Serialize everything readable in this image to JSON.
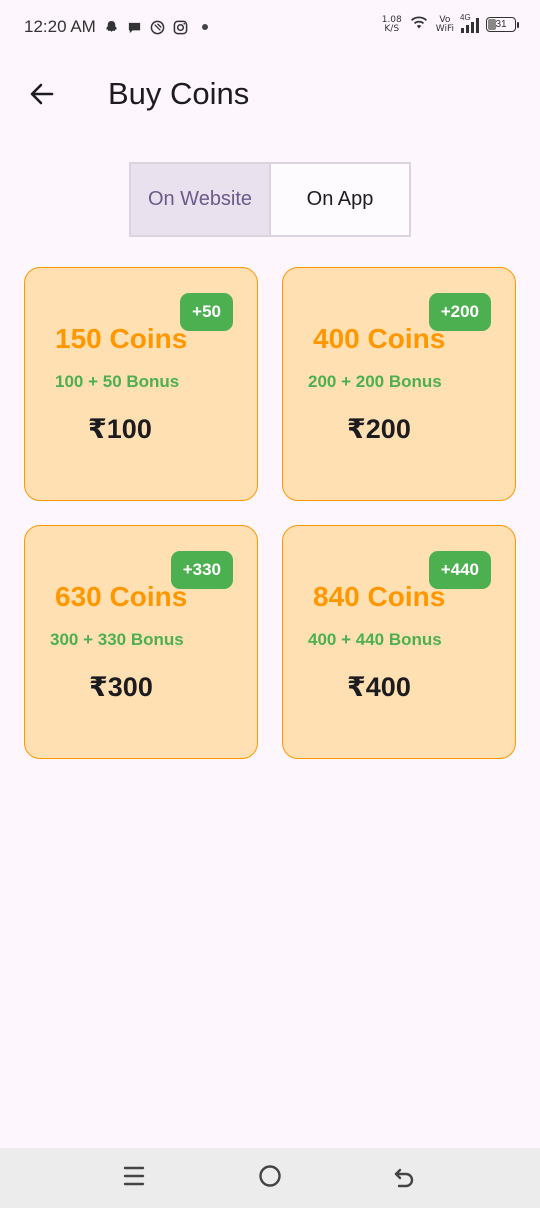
{
  "status_bar": {
    "time": "12:20 AM",
    "net_speed_value": "1.08",
    "net_speed_unit": "K/S",
    "volte_top": "Vo",
    "volte_bottom": "WiFi",
    "network_type": "4G",
    "battery": "31"
  },
  "header": {
    "title": "Buy Coins"
  },
  "tabs": [
    {
      "label": "On Website",
      "active": true
    },
    {
      "label": "On App",
      "active": false
    }
  ],
  "packages": [
    {
      "badge": "+50",
      "coins": "150 Coins",
      "bonus": "100 + 50 Bonus",
      "price": "₹100"
    },
    {
      "badge": "+200",
      "coins": "400 Coins",
      "bonus": "200 + 200 Bonus",
      "price": "₹200"
    },
    {
      "badge": "+330",
      "coins": "630 Coins",
      "bonus": "300 + 330 Bonus",
      "price": "₹300"
    },
    {
      "badge": "+440",
      "coins": "840 Coins",
      "bonus": "400 + 440 Bonus",
      "price": "₹400"
    }
  ],
  "colors": {
    "card_bg": "#ffe0b2",
    "card_border": "#ff9800",
    "coins_text": "#ff9800",
    "bonus_text": "#4caf50",
    "badge_bg": "#4caf50",
    "active_tab_bg": "#e9e1ee",
    "active_tab_text": "#6b5a8a"
  },
  "icons": {
    "back": "arrow-left-icon",
    "nav_recents": "menu-lines-icon",
    "nav_home": "circle-icon",
    "nav_back": "undo-arrow-icon"
  }
}
